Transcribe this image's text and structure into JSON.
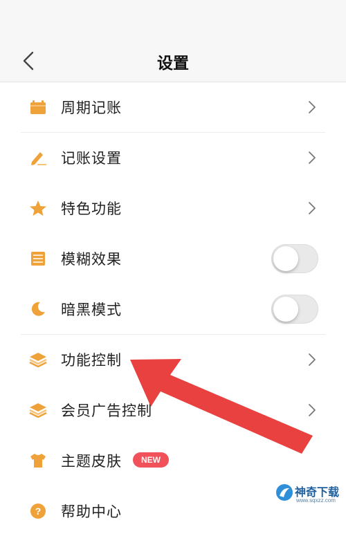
{
  "header": {
    "title": "设置"
  },
  "items": [
    {
      "label": "周期记账",
      "icon": "calendar-icon",
      "control": "chevron"
    },
    {
      "label": "记账设置",
      "icon": "pencil-icon",
      "control": "chevron"
    },
    {
      "label": "特色功能",
      "icon": "star-icon",
      "control": "chevron"
    },
    {
      "label": "模糊效果",
      "icon": "blur-icon",
      "control": "toggle",
      "toggle_on": false
    },
    {
      "label": "暗黑模式",
      "icon": "moon-icon",
      "control": "toggle",
      "toggle_on": false
    },
    {
      "label": "功能控制",
      "icon": "layers-icon",
      "control": "chevron"
    },
    {
      "label": "会员广告控制",
      "icon": "layers-icon",
      "control": "chevron"
    },
    {
      "label": "主题皮肤",
      "icon": "tshirt-icon",
      "control": "badge",
      "badge": "NEW"
    },
    {
      "label": "帮助中心",
      "icon": "help-icon",
      "control": "chevron"
    }
  ],
  "colors": {
    "icon": "#f0a23a",
    "arrow": "#e8413f",
    "badge": "#f0515a"
  },
  "watermark": {
    "title": "神奇下载",
    "url": "www.sqxzz.com"
  }
}
